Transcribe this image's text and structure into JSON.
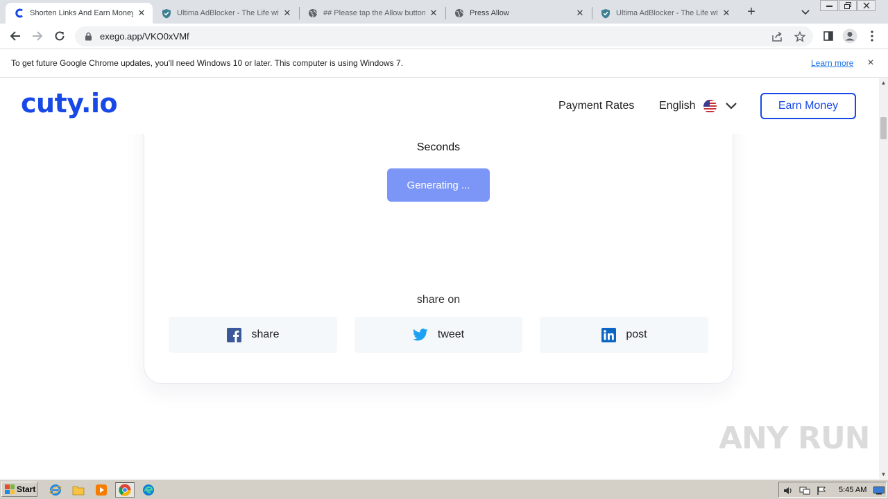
{
  "browser": {
    "tabs": [
      {
        "title": "Shorten Links And Earn Money",
        "active": true,
        "icon": "cuty-favicon"
      },
      {
        "title": "Ultima AdBlocker - The Life with",
        "active": false,
        "icon": "shield-icon"
      },
      {
        "title": "## Please tap the Allow button",
        "active": false,
        "icon": "globe-icon"
      },
      {
        "title": "Press Allow",
        "active": false,
        "icon": "globe-icon"
      },
      {
        "title": "Ultima AdBlocker - The Life with",
        "active": false,
        "icon": "shield-icon"
      }
    ],
    "new_tab": "+",
    "url": "exego.app/VKO0xVMf",
    "infobar": {
      "message": "To get future Google Chrome updates, you'll need Windows 10 or later. This computer is using Windows 7.",
      "link": "Learn more",
      "close": "×"
    }
  },
  "site": {
    "logo": "cuty.io",
    "nav": {
      "payment_rates": "Payment Rates",
      "language": "English",
      "earn_money": "Earn Money"
    },
    "timer_unit": "Seconds",
    "generate_button": "Generating ...",
    "share_heading": "share on",
    "share_buttons": [
      {
        "label": "share",
        "icon": "facebook-icon",
        "color": "#3b5998"
      },
      {
        "label": "tweet",
        "icon": "twitter-icon",
        "color": "#1da1f2"
      },
      {
        "label": "post",
        "icon": "linkedin-icon",
        "color": "#0a66c2"
      }
    ],
    "colors": {
      "brand": "#1849e6",
      "generate_button_bg": "#7c96f7",
      "share_bg": "#f5f8fb"
    }
  },
  "watermark": "ANY RUN",
  "taskbar": {
    "start": "Start",
    "clock": "5:45 AM"
  }
}
